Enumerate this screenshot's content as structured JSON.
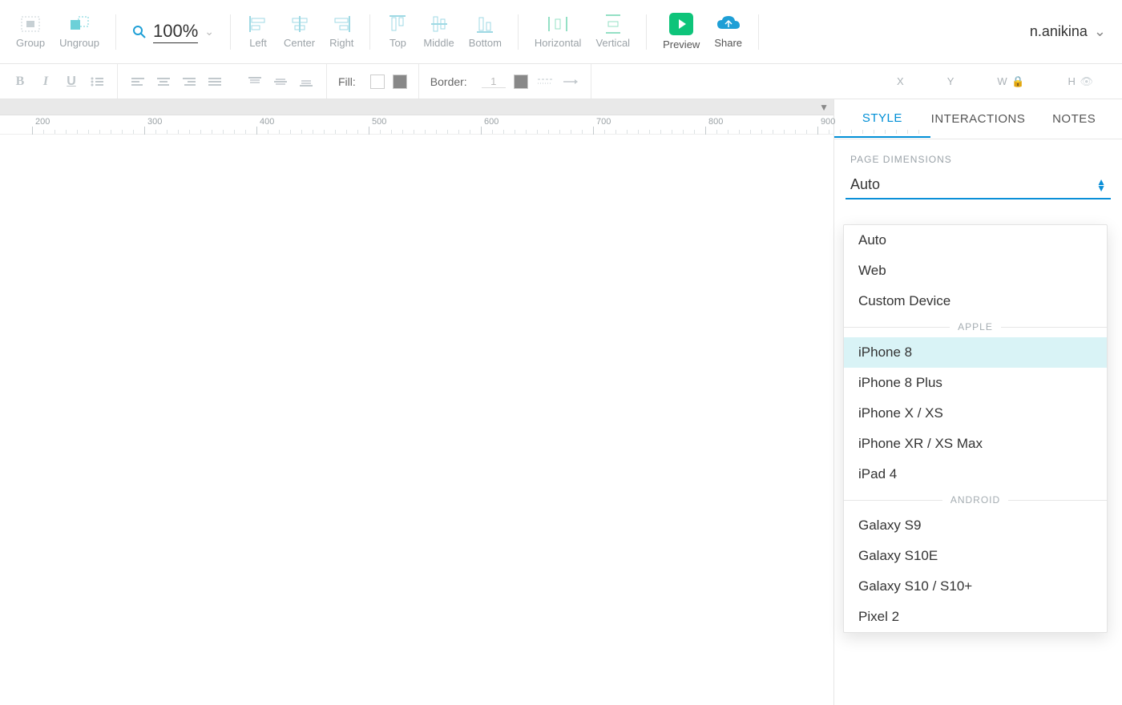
{
  "toolbar": {
    "group": "Group",
    "ungroup": "Ungroup",
    "zoom": "100%",
    "align": {
      "left": "Left",
      "center": "Center",
      "right": "Right",
      "top": "Top",
      "middle": "Middle",
      "bottom": "Bottom"
    },
    "distribute": {
      "horizontal": "Horizontal",
      "vertical": "Vertical"
    },
    "preview": "Preview",
    "share": "Share"
  },
  "user": {
    "name": "n.anikina"
  },
  "format": {
    "fill_label": "Fill:",
    "border_label": "Border:",
    "border_value": "1",
    "coords": {
      "x": "X",
      "y": "Y",
      "w": "W",
      "h": "H"
    }
  },
  "ruler": {
    "ticks": [
      200,
      300,
      400,
      500,
      600,
      700,
      800,
      900
    ]
  },
  "right_panel": {
    "tabs": [
      "STYLE",
      "INTERACTIONS",
      "NOTES"
    ],
    "active_tab": 0,
    "section": "PAGE DIMENSIONS",
    "selected": "Auto"
  },
  "dropdown": {
    "top": [
      "Auto",
      "Web",
      "Custom Device"
    ],
    "groups": [
      {
        "label": "APPLE",
        "items": [
          "iPhone 8",
          "iPhone 8 Plus",
          "iPhone X / XS",
          "iPhone XR / XS Max",
          "iPad 4"
        ],
        "highlight": "iPhone 8"
      },
      {
        "label": "ANDROID",
        "items": [
          "Galaxy S9",
          "Galaxy S10E",
          "Galaxy S10 / S10+",
          "Pixel 2"
        ]
      }
    ]
  }
}
